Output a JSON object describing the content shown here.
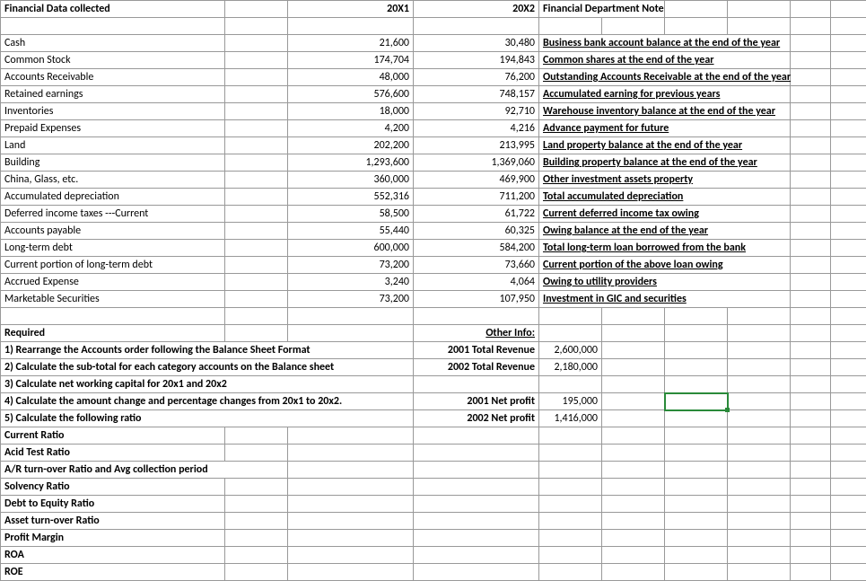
{
  "header": {
    "title": "Financial Data collected",
    "col_20x1": "20X1",
    "col_20x2": "20X2",
    "col_note": "Financial Department Note"
  },
  "rows": [
    {
      "label": "Cash",
      "v1": "21,600",
      "v2": "30,480",
      "note": "Business bank account balance at the end of the year"
    },
    {
      "label": "Common Stock",
      "v1": "174,704",
      "v2": "194,843",
      "note": "Common shares at the end of the year"
    },
    {
      "label": "Accounts Receivable",
      "v1": "48,000",
      "v2": "76,200",
      "note": "Outstanding Accounts Receivable at the end of the year"
    },
    {
      "label": "Retained earnings",
      "v1": "576,600",
      "v2": "748,157",
      "note": "Accumulated earning for previous years"
    },
    {
      "label": "Inventories",
      "v1": "18,000",
      "v2": "92,710",
      "note": "Warehouse inventory balance at the end of the year"
    },
    {
      "label": "Prepaid Expenses",
      "v1": "4,200",
      "v2": "4,216",
      "note": "Advance payment for future"
    },
    {
      "label": "Land",
      "v1": "202,200",
      "v2": "213,995",
      "note": "Land property balance at the end of the year"
    },
    {
      "label": "Building",
      "v1": "1,293,600",
      "v2": "1,369,060",
      "note": "Building property balance at the end of the year"
    },
    {
      "label": "China, Glass, etc.",
      "v1": "360,000",
      "v2": "469,900",
      "note": "Other investment assets property"
    },
    {
      "label": "Accumulated depreciation",
      "v1": "552,316",
      "v2": "711,200",
      "note": "Total accumulated depreciation"
    },
    {
      "label": "Deferred income taxes ---Current",
      "v1": "58,500",
      "v2": "61,722",
      "note": "Current deferred income tax owing"
    },
    {
      "label": "Accounts payable",
      "v1": "55,440",
      "v2": "60,325",
      "note": "Owing balance at the end of the year"
    },
    {
      "label": "Long-term debt",
      "v1": "600,000",
      "v2": "584,200",
      "note": "Total long-term loan borrowed from the bank"
    },
    {
      "label": "Current portion of long-term debt",
      "v1": "73,200",
      "v2": "73,660",
      "note": "Current portion of the above loan owing"
    },
    {
      "label": "Accrued Expense",
      "v1": "3,240",
      "v2": "4,064",
      "note": "Owing to utility providers"
    },
    {
      "label": "Marketable Securities",
      "v1": "73,200",
      "v2": "107,950",
      "note": "Investment in GIC and securities"
    }
  ],
  "required": {
    "heading": "Required",
    "other_info": "Other Info:",
    "items": [
      "1) Rearrange the Accounts order following the Balance Sheet Format",
      "2) Calculate the sub-total for each category accounts on the Balance sheet",
      "3) Calculate net working capital for 20x1 and 20x2",
      "4) Calculate the amount change and percentage changes from 20x1 to 20x2.",
      "5) Calculate the following ratio"
    ],
    "ratios": [
      "Current Ratio",
      "Acid Test Ratio",
      "A/R turn-over Ratio and Avg collection period",
      "Solvency Ratio",
      "Debt to Equity Ratio",
      "Asset turn-over Ratio",
      "Profit Margin",
      "ROA",
      "ROE"
    ]
  },
  "other": {
    "rev2001_label": "2001 Total Revenue",
    "rev2001_value": "2,600,000",
    "rev2002_label": "2002 Total Revenue",
    "rev2002_value": "2,180,000",
    "np2001_label": "2001 Net profit",
    "np2001_value": "195,000",
    "np2002_label": "2002 Net profit",
    "np2002_value": "1,416,000"
  }
}
